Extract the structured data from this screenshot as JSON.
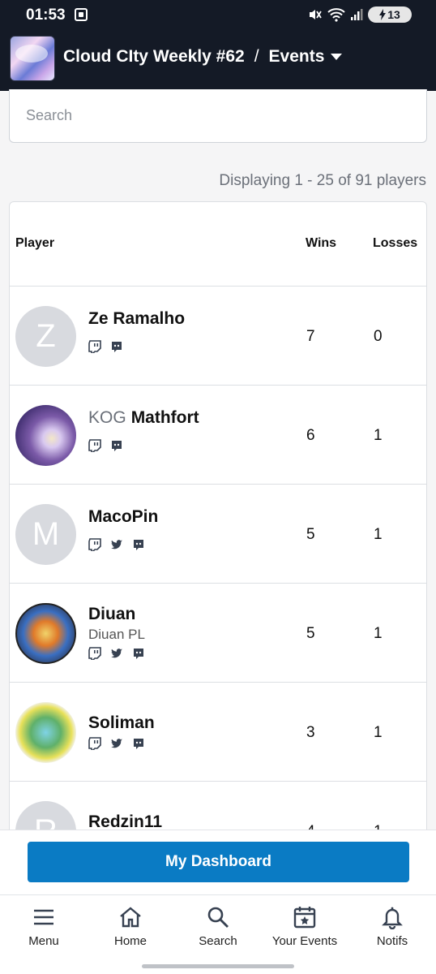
{
  "status_bar": {
    "time": "01:53",
    "battery": "13"
  },
  "header": {
    "event_title": "Cloud CIty Weekly #62",
    "separator": "/",
    "section": "Events"
  },
  "search": {
    "placeholder": "Search",
    "value": ""
  },
  "display_count": "Displaying 1 - 25 of 91 players",
  "table": {
    "headers": {
      "player": "Player",
      "wins": "Wins",
      "losses": "Losses"
    },
    "rows": [
      {
        "initial": "Z",
        "tag": "",
        "name": "Ze Ramalho",
        "subtitle": "",
        "socials": [
          "twitch-icon",
          "discord-icon"
        ],
        "wins": "7",
        "losses": "0"
      },
      {
        "initial": "",
        "tag": "KOG",
        "name": "Mathfort",
        "subtitle": "",
        "socials": [
          "twitch-icon",
          "discord-icon"
        ],
        "wins": "6",
        "losses": "1"
      },
      {
        "initial": "M",
        "tag": "",
        "name": "MacoPin",
        "subtitle": "",
        "socials": [
          "twitch-icon",
          "twitter-icon",
          "discord-icon"
        ],
        "wins": "5",
        "losses": "1"
      },
      {
        "initial": "",
        "tag": "",
        "name": "Diuan",
        "subtitle": "Diuan PL",
        "socials": [
          "twitch-icon",
          "twitter-icon",
          "discord-icon"
        ],
        "wins": "5",
        "losses": "1"
      },
      {
        "initial": "",
        "tag": "",
        "name": "Soliman",
        "subtitle": "",
        "socials": [
          "twitch-icon",
          "twitter-icon",
          "discord-icon"
        ],
        "wins": "3",
        "losses": "1"
      },
      {
        "initial": "R",
        "tag": "",
        "name": "Redzin11",
        "subtitle": "",
        "socials": [],
        "wins": "4",
        "losses": "1"
      }
    ]
  },
  "dashboard_button": "My Dashboard",
  "nav": [
    {
      "label": "Menu",
      "icon": "menu-icon"
    },
    {
      "label": "Home",
      "icon": "home-icon"
    },
    {
      "label": "Search",
      "icon": "search-icon"
    },
    {
      "label": "Your Events",
      "icon": "calendar-star-icon"
    },
    {
      "label": "Notifs",
      "icon": "bell-icon"
    }
  ]
}
